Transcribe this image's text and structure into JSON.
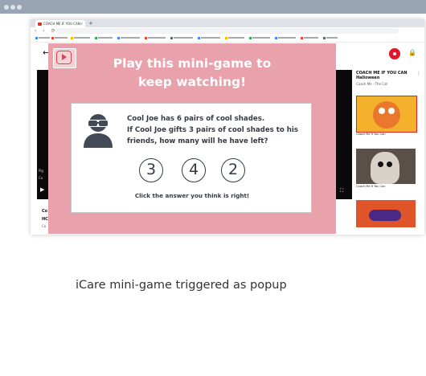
{
  "browser": {
    "tab_title": "COACH ME IF YOU CAN",
    "tab_close": "×",
    "new_tab": "+",
    "nav_icons": "‹ › ⟳"
  },
  "youtube": {
    "back_arrow": "←",
    "player_text": {
      "line_a": "Pig",
      "line_b": "Co"
    },
    "under_player": {
      "line1": "Co",
      "line2": "HC",
      "line3": "Co"
    },
    "sidebar": {
      "title": "COACH ME IF YOU CAN Halloween",
      "sub": "Coach Me - The Cat",
      "item1_caption": "Coach Me If You Can",
      "item2_caption": "Coach Me If You Can"
    }
  },
  "popup": {
    "title_line1": "Play this mini-game to",
    "title_line2": "keep watching!",
    "question_line1": "Cool Joe has 6 pairs of cool shades.",
    "question_line2": "If Cool Joe gifts 3 pairs of cool shades to his",
    "question_line3": "friends, how many will he have left?",
    "answers": [
      "3",
      "4",
      "2"
    ],
    "hint": "Click the answer you think is right!"
  },
  "caption": "iCare mini-game triggered as popup",
  "colors": {
    "popup_bg": "#e9a2ab",
    "text_dark": "#333a44",
    "youtube_red": "#e4162b"
  }
}
